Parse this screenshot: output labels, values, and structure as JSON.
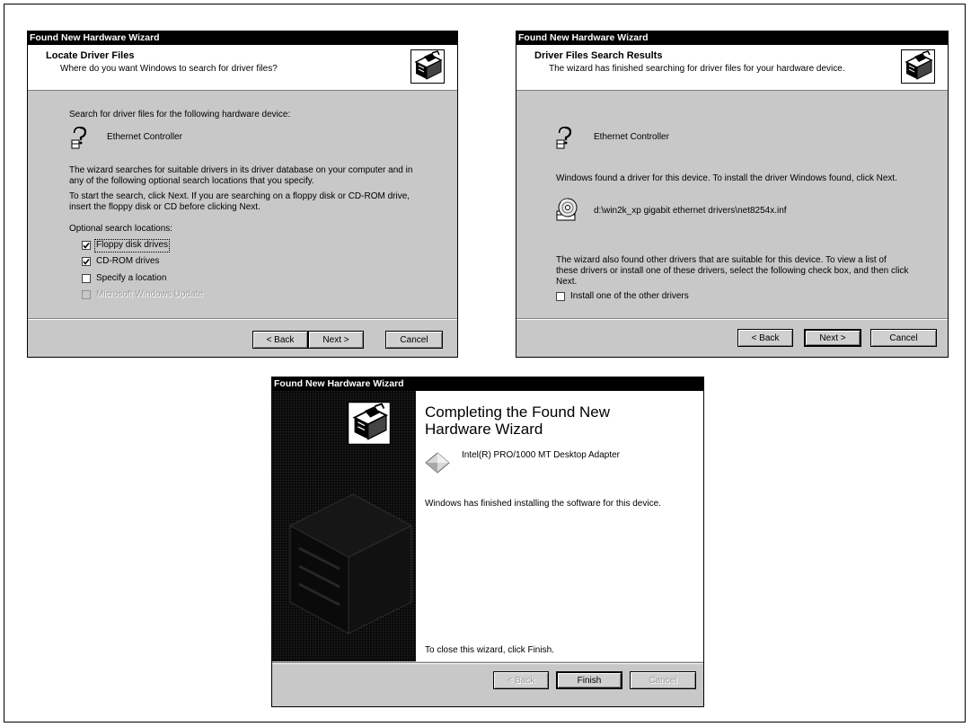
{
  "dialog1": {
    "title": "Found New Hardware Wizard",
    "header_title": "Locate Driver Files",
    "header_sub": "Where do you want Windows to search for driver files?",
    "intro": "Search for driver files for the following hardware device:",
    "device_name": "Ethernet Controller",
    "para1_line1": "The wizard searches for suitable drivers in its driver database on your computer and in",
    "para1_line2": "any of the following optional search locations that you specify.",
    "para2_line1": "To start the search, click Next. If you are searching on a floppy disk or CD-ROM drive,",
    "para2_line2": "insert the floppy disk or CD before clicking Next.",
    "optional_label": "Optional search locations:",
    "options": [
      {
        "label": "Floppy disk drives",
        "checked": true,
        "enabled": true
      },
      {
        "label": "CD-ROM drives",
        "checked": true,
        "enabled": true
      },
      {
        "label": "Specify a location",
        "checked": false,
        "enabled": true
      },
      {
        "label": "Microsoft Windows Update",
        "checked": false,
        "enabled": false
      }
    ],
    "back_label": "< Back",
    "next_label": "Next >",
    "cancel_label": "Cancel"
  },
  "dialog2": {
    "title": "Found New Hardware Wizard",
    "header_title": "Driver Files Search Results",
    "header_sub": "The wizard has finished searching for driver files for your hardware device.",
    "device_name": "Ethernet Controller",
    "found_text": "Windows found a driver for this device. To install the driver Windows found, click Next.",
    "driver_path": "d:\\win2k_xp gigabit ethernet drivers\\net8254x.inf",
    "also_line1": "The wizard also found other drivers that are suitable for this device. To view a list of",
    "also_line2": "these drivers or install one of these drivers, select the following check box, and then click",
    "also_line3": "Next.",
    "other_drivers_label": "Install one of the other drivers",
    "other_drivers_checked": false,
    "back_label": "< Back",
    "next_label": "Next >",
    "cancel_label": "Cancel"
  },
  "dialog3": {
    "title": "Found New Hardware Wizard",
    "heading_line1": "Completing the Found New",
    "heading_line2": "Hardware Wizard",
    "device_name": "Intel(R) PRO/1000 MT Desktop Adapter",
    "finished_text": "Windows has finished installing the software for this device.",
    "close_text": "To close this wizard, click Finish.",
    "back_label": "< Back",
    "finish_label": "Finish",
    "cancel_label": "Cancel"
  },
  "icons": {
    "hardware_wizard": "hardware-wizard-icon",
    "unknown_device": "unknown-device-icon",
    "cd_driver": "cd-driver-icon",
    "network_adapter": "network-adapter-icon"
  }
}
